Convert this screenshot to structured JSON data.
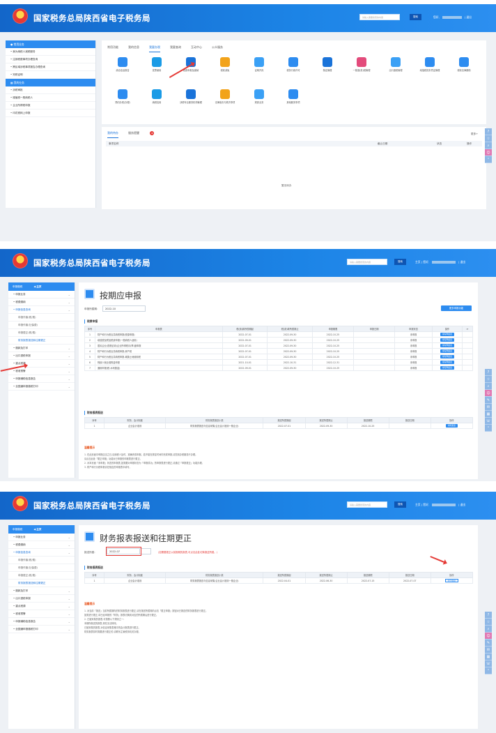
{
  "header": {
    "title": "国家税务总局陕西省电子税务局",
    "search_placeholder": "请输入需要搜索的内容",
    "search_button": "搜索",
    "home_link": "主页",
    "user_prefix": "您好,",
    "logout": "退出"
  },
  "shot1": {
    "sidebar": {
      "section1": "常用业务",
      "items1": [
        "我为纳税人减税服务",
        "注销税费事项办理查询",
        "跨区域涉税事项报告办理查询",
        "完税证明"
      ],
      "section2": "我的业务",
      "items2": [
        "涉税审批",
        "增值税一般纳税人",
        "企业所得税申报",
        "印花税网上申报"
      ]
    },
    "tabs": [
      "常用功能",
      "我的信息",
      "我要办税",
      "我要查询",
      "互动中心",
      "公众服务"
    ],
    "active_tab": 2,
    "icons_row1": [
      "综合信息报告",
      "发票使用",
      "税费申报及缴纳",
      "税收减免",
      "证明开具",
      "税务行政许可",
      "核定管理",
      "一般退(抵)税管理",
      "出口退税管理",
      "增值税抵扣凭证管理",
      "税收法律援助"
    ],
    "icons_row2": [
      "预约办税(办理)",
      "纳税信用",
      "涉税专业服务机构管理",
      "法律追责与救济事项",
      "规费业务",
      "其他服务事项"
    ],
    "todo_tabs": [
      "我的待办",
      "服务提醒"
    ],
    "todo_badge": "2",
    "more": "更多+",
    "todo_headers": [
      "事项名称",
      "截止日期",
      "状态",
      "操作"
    ],
    "empty": "暂无待办"
  },
  "shot2": {
    "sidebar": {
      "top_label": "申报缴税",
      "top_home": "主页",
      "items": [
        {
          "label": "申报业务",
          "type": "group"
        },
        {
          "label": "税费缴纳",
          "type": "group"
        },
        {
          "label": "申报信息查询",
          "type": "group-hl"
        },
        {
          "label": "申报作废(税/费)",
          "type": "sub"
        },
        {
          "label": "申报作废(社保费)",
          "type": "sub"
        },
        {
          "label": "申报更正(税/费)",
          "type": "sub"
        },
        {
          "label": "财务报表报送和往期更正",
          "type": "sub-hl"
        },
        {
          "label": "缴款及打印",
          "type": "group"
        },
        {
          "label": "出口退税申报",
          "type": "group"
        },
        {
          "label": "重点税源",
          "type": "group"
        },
        {
          "label": "税收预警",
          "type": "group"
        },
        {
          "label": "申报辅助信息报告",
          "type": "group"
        },
        {
          "label": "全国通申报缴税打印",
          "type": "group"
        }
      ]
    },
    "page_title": "按期应申报",
    "period_label": "申报所属期:",
    "period_value": "2022-10",
    "right_button": "更多申报功能",
    "section1": "税费申报",
    "table1_headers": [
      "序号",
      "申报表",
      "税(费)款所属期起",
      "税(费)款所属期止",
      "申报期限",
      "申报日期",
      "申报状态",
      "操作",
      "刷新"
    ],
    "table1_rows": [
      [
        "1",
        "财产和行为税合并纳税申报(税源申报)",
        "2022-07-01",
        "2022-09-30",
        "2022-10-25",
        "",
        "未申报",
        "填写申报表"
      ],
      [
        "2",
        "增值税及附加税费申报(一般纳税人适用)",
        "2022-09-01",
        "2022-09-30",
        "2022-10-25",
        "",
        "未申报",
        "填写申报表"
      ],
      [
        "3",
        "居民企业(查账征收)企业所得税月(季)度申报",
        "2022-07-01",
        "2022-09-30",
        "2022-10-25",
        "",
        "未申报",
        "填写申报表"
      ],
      [
        "4",
        "财产和行为税合并纳税申报-房产税",
        "2022-07-01",
        "2022-09-30",
        "2022-10-25",
        "",
        "未申报",
        "填写申报表"
      ],
      [
        "5",
        "财产和行为税合并纳税申报-城镇土地使用税",
        "2022-07-01",
        "2022-09-30",
        "2022-10-25",
        "",
        "未申报",
        "填写申报表"
      ],
      [
        "6",
        "残疾人就业保障金申报",
        "2021-10-01",
        "2022-10-31",
        "2022-12-31",
        "",
        "未申报",
        "填写申报表"
      ],
      [
        "7",
        "通用申报(税-水利基金)",
        "2022-09-01",
        "2022-09-30",
        "2022-10-25",
        "",
        "未申报",
        "填写申报表"
      ]
    ],
    "section2": "财务报表报送",
    "table2_headers": [
      "序号",
      "财务、会计制度",
      "财务报表报送小类",
      "报送所属期起",
      "报送所属期止",
      "报送期限",
      "报送日期",
      "操作"
    ],
    "table2_rows": [
      [
        "1",
        "企业会计准则",
        "财务报表报送与信息采集(企业会计准则一般企业)",
        "2022-07-01",
        "2022-09-30",
        "2022-10-25",
        "",
        "填写报表"
      ]
    ],
    "tips_title": "温馨提示",
    "tips": [
      "1. 在此页面中申报应当之日,请纳税人及时、准确完成申报。若不能在规定时间内完成申报,请您到办税服务厅办理。",
      "请点击此处「更正申报」功能对已申报的申报表进行更正。",
      "2. 对本页面「未申报」状态的申报表,如需要对申报状态为「申报成功」的申报表进行更正,请通过「申报更正」功能办理。",
      "3. 财产和行为税申报请在相应的申报表中填写。"
    ]
  },
  "shot3": {
    "page_title": "财务报表报送和往期更正",
    "period_label": "报送所属:",
    "period_value": "2022-07",
    "warning": "(如需要更正以前报期的报表,可点击此处切换报送所属。)",
    "section": "财务报表报送",
    "table_headers": [
      "序号",
      "财务、会计制度",
      "财务报表报送小类",
      "报送所属期起",
      "报送所属期止",
      "报送期限",
      "报送日期",
      "操作"
    ],
    "table_rows": [
      [
        "1",
        "企业会计准则",
        "财务报表报送与信息采集(企业会计准则一般企业)",
        "2022-04-01",
        "2022-06-30",
        "2022-07-15",
        "2022-07-07",
        "更正申报"
      ]
    ],
    "tips_title": "温馨提示",
    "tips": [
      "1. 对当前「报送」当前所属期内的财务报表进行更正,请在报送所属期内点击「更正申报」按钮对已报送的财务报表进行更正。",
      "如需进行更正,将已经申报的「财务」报表切换到对应的所属期后进行更正。",
      "2. 已被采集的报表,可按照以下规则之一:",
      "本期所报送的报表,现在无法修改。",
      "已被采集的报表,对信息采集表格中的会计报表进行更正。",
      "财务报表暂时需要进行更正的,请联系主管税务机关办理。"
    ]
  },
  "colors": {
    "header_blue": "#1c84e6",
    "accent": "#2d8cf0",
    "highlight_red": "#e53935"
  }
}
